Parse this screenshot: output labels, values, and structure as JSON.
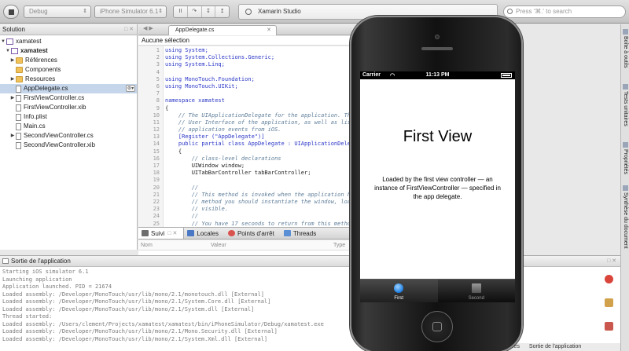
{
  "toolbar": {
    "config_combo": "Debug",
    "target_combo": "iPhone Simulator 6.1",
    "segments": [
      "II",
      "↷",
      "↧",
      "↥"
    ],
    "status_text": "Xamarin Studio",
    "search_placeholder": "Press '⌘.' to search"
  },
  "solution": {
    "title": "Solution",
    "items": [
      {
        "label": "xamatest",
        "kind": "solution",
        "indent": 0
      },
      {
        "label": "xamatest",
        "kind": "project",
        "indent": 1,
        "bold": true
      },
      {
        "label": "Références",
        "kind": "folder",
        "indent": 2,
        "expandable": true
      },
      {
        "label": "Components",
        "kind": "folder",
        "indent": 2
      },
      {
        "label": "Resources",
        "kind": "folder",
        "indent": 2,
        "expandable": true
      },
      {
        "label": "AppDelegate.cs",
        "kind": "file",
        "indent": 2,
        "selected": true
      },
      {
        "label": "FirstViewController.cs",
        "kind": "file",
        "indent": 2,
        "expandable": true
      },
      {
        "label": "FirstViewController.xib",
        "kind": "file",
        "indent": 2
      },
      {
        "label": "Info.plist",
        "kind": "file",
        "indent": 2
      },
      {
        "label": "Main.cs",
        "kind": "file",
        "indent": 2
      },
      {
        "label": "SecondViewController.cs",
        "kind": "file",
        "indent": 2,
        "expandable": true
      },
      {
        "label": "SecondViewController.xib",
        "kind": "file",
        "indent": 2
      }
    ]
  },
  "editor": {
    "tab_label": "AppDelegate.cs",
    "breadcrumb": "Aucune sélection",
    "lines": [
      {
        "n": "1",
        "t": "using System;"
      },
      {
        "n": "2",
        "t": "using System.Collections.Generic;"
      },
      {
        "n": "3",
        "t": "using System.Linq;"
      },
      {
        "n": "4",
        "t": ""
      },
      {
        "n": "5",
        "t": "using MonoTouch.Foundation;"
      },
      {
        "n": "6",
        "t": "using MonoTouch.UIKit;"
      },
      {
        "n": "7",
        "t": ""
      },
      {
        "n": "8",
        "t": "namespace xamatest"
      },
      {
        "n": "9",
        "t": "{"
      },
      {
        "n": "10",
        "t": "    // The UIApplicationDelegate for the application. This"
      },
      {
        "n": "11",
        "t": "    // User Interface of the application, as well as liste"
      },
      {
        "n": "12",
        "t": "    // application events from iOS."
      },
      {
        "n": "13",
        "t": "    [Register (\"AppDelegate\")]"
      },
      {
        "n": "14",
        "t": "    public partial class AppDelegate : UIApplicationDelega"
      },
      {
        "n": "15",
        "t": "    {"
      },
      {
        "n": "16",
        "t": "        // class-level declarations"
      },
      {
        "n": "17",
        "t": "        UIWindow window;"
      },
      {
        "n": "18",
        "t": "        UITabBarController tabBarController;"
      },
      {
        "n": "19",
        "t": ""
      },
      {
        "n": "20",
        "t": "        //"
      },
      {
        "n": "21",
        "t": "        // This method is invoked when the application has"
      },
      {
        "n": "22",
        "t": "        // method you should instantiate the window, load t"
      },
      {
        "n": "23",
        "t": "        // visible."
      },
      {
        "n": "24",
        "t": "        //"
      },
      {
        "n": "25",
        "t": "        // You have 17 seconds to return from this method,"
      }
    ]
  },
  "pads": {
    "tabs": [
      "Suivi",
      "Locales",
      "Points d'arrêt",
      "Threads"
    ],
    "columns": [
      "Nom",
      "Valeur",
      "Type"
    ]
  },
  "output": {
    "title": "Sortie de l'application",
    "lines": [
      "Starting iOS simulator 6.1",
      "Launching application",
      "Application launched. PID = 21674",
      "Loaded assembly: /Developer/MonoTouch/usr/lib/mono/2.1/monotouch.dll [External]",
      "Loaded assembly: /Developer/MonoTouch/usr/lib/mono/2.1/System.Core.dll [External]",
      "Loaded assembly: /Developer/MonoTouch/usr/lib/mono/2.1/System.dll [External]",
      "Thread started:",
      "Loaded assembly: /Users/clement/Projects/xamatest/xamatest/bin/iPhoneSimulator/Debug/xamatest.exe",
      "Loaded assembly: /Developer/MonoTouch/usr/lib/mono/2.1/Mono.Security.dll [External]",
      "Loaded assembly: /Developer/MonoTouch/usr/lib/mono/2.1/System.Xml.dll [External]"
    ],
    "status_tasks": "Tâches",
    "status_output": "Sortie de l'application"
  },
  "right_pads": [
    "Boîte à outils",
    "Tests unitaires",
    "Propriétés",
    "Synthèse du document"
  ],
  "simulator": {
    "carrier": "Carrier",
    "time": "11:13 PM",
    "title": "First View",
    "body": "Loaded by the first view controller — an instance of FirstViewController — specified in the app delegate.",
    "tab_first": "First",
    "tab_second": "Second"
  },
  "colors": {
    "selection": "#c5d5ea",
    "keyword": "#2a37c6",
    "comment": "#5f7e9a",
    "string": "#c0392b",
    "first_tab_icon": "#1c7ee2"
  }
}
